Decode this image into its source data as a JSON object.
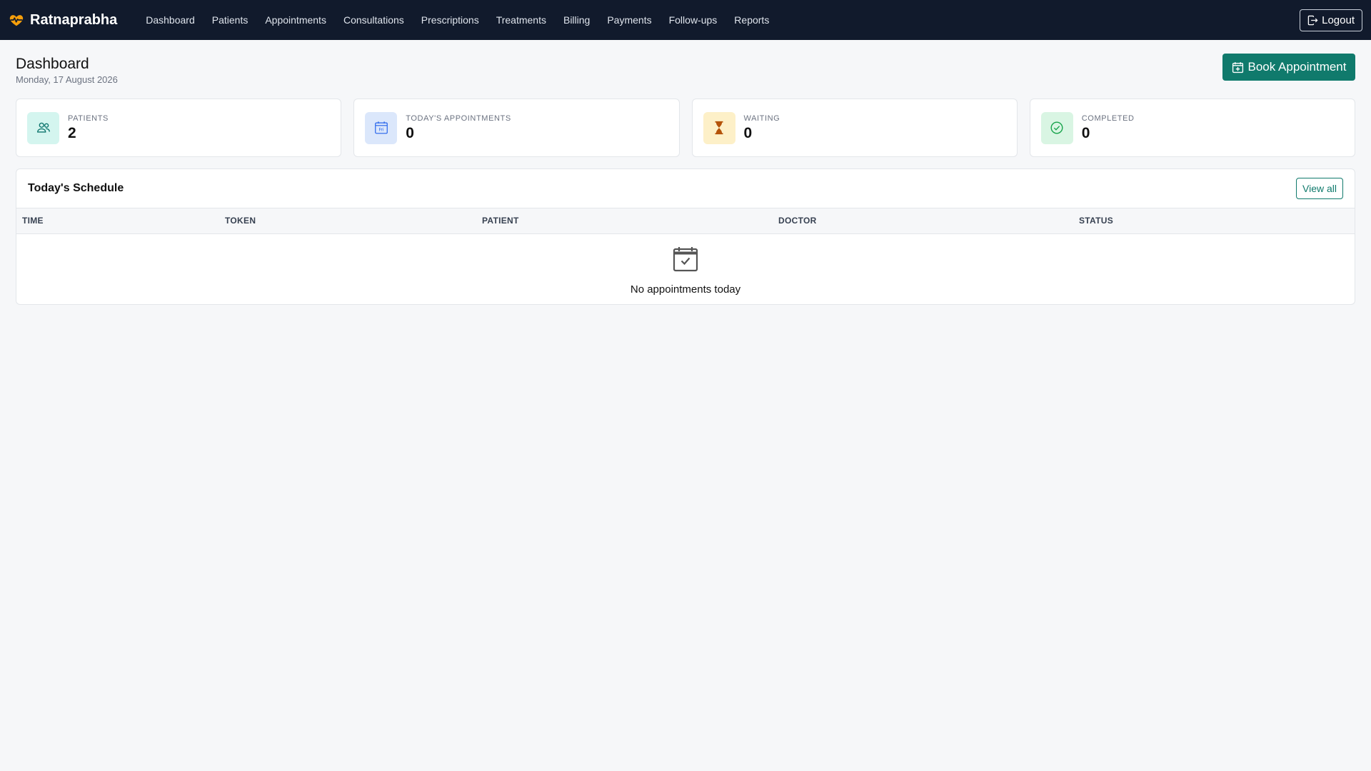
{
  "brand": {
    "name": "Ratnaprabha",
    "icon": "heart-pulse-icon",
    "icon_color": "#f59e0b"
  },
  "nav": {
    "items": [
      {
        "label": "Dashboard"
      },
      {
        "label": "Patients"
      },
      {
        "label": "Appointments"
      },
      {
        "label": "Consultations"
      },
      {
        "label": "Prescriptions"
      },
      {
        "label": "Treatments"
      },
      {
        "label": "Billing"
      },
      {
        "label": "Payments"
      },
      {
        "label": "Follow-ups"
      },
      {
        "label": "Reports"
      }
    ],
    "logout_label": "Logout"
  },
  "header": {
    "title": "Dashboard",
    "date": "Monday, 17 August 2026",
    "book_label": "Book Appointment"
  },
  "stats": [
    {
      "label": "PATIENTS",
      "value": "2",
      "icon": "users-icon",
      "bg": "#d4f5ef",
      "color": "#0f766e"
    },
    {
      "label": "TODAY'S APPOINTMENTS",
      "value": "0",
      "icon": "calendar-icon",
      "icon_text": "Fri",
      "bg": "#dbe7fb",
      "color": "#2563eb"
    },
    {
      "label": "WAITING",
      "value": "0",
      "icon": "hourglass-icon",
      "bg": "#fdf0c8",
      "color": "#b45309"
    },
    {
      "label": "COMPLETED",
      "value": "0",
      "icon": "check-circle-icon",
      "bg": "#d9f5e3",
      "color": "#16a34a"
    }
  ],
  "schedule": {
    "title": "Today's Schedule",
    "view_all_label": "View all",
    "columns": [
      "TIME",
      "TOKEN",
      "PATIENT",
      "DOCTOR",
      "STATUS"
    ],
    "empty_text": "No appointments today"
  }
}
